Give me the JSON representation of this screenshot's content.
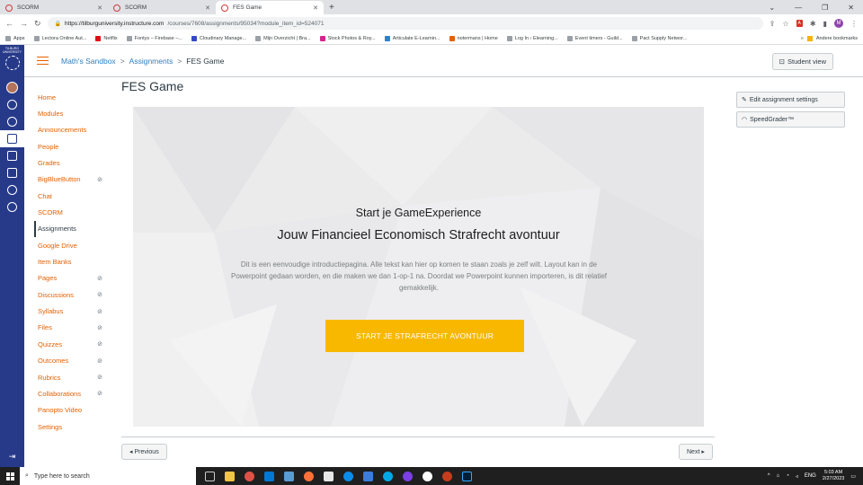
{
  "browser": {
    "tabs": [
      {
        "title": "SCORM",
        "active": false
      },
      {
        "title": "SCORM",
        "active": false
      },
      {
        "title": "FES Game",
        "active": true
      }
    ],
    "url_host": "https://tilburguniversity.instructure.com",
    "url_path": "/courses/7608/assignments/95034?module_item_id=524071",
    "bookmarks": [
      "Apps",
      "Lectora Online Aut...",
      "Netflix",
      "Fontys – Firebase –...",
      "Cloudinary Manage...",
      "Mijn Overzicht | Bra...",
      "Stock Photos & Roy...",
      "Articulate E-Learnin...",
      "notermans | Home",
      "Log In ‹ Elearning...",
      "Event timers - Guild...",
      "Pact Supply Networ..."
    ],
    "bookmarks_more": "»",
    "other_bookmarks": "Andere bookmarks",
    "profile_initial": "M"
  },
  "logo": {
    "line1": "TILBURG",
    "line2": "UNIVERSITY"
  },
  "breadcrumb": {
    "course": "Math's Sandbox",
    "section": "Assignments",
    "current": "FES Game",
    "sep": ">"
  },
  "header": {
    "student_view": "Student view"
  },
  "course_nav": [
    {
      "label": "Home",
      "hidden": false,
      "active": false
    },
    {
      "label": "Modules",
      "hidden": false,
      "active": false
    },
    {
      "label": "Announcements",
      "hidden": false,
      "active": false
    },
    {
      "label": "People",
      "hidden": false,
      "active": false
    },
    {
      "label": "Grades",
      "hidden": false,
      "active": false
    },
    {
      "label": "BigBlueButton",
      "hidden": true,
      "active": false
    },
    {
      "label": "Chat",
      "hidden": false,
      "active": false
    },
    {
      "label": "SCORM",
      "hidden": false,
      "active": false
    },
    {
      "label": "Assignments",
      "hidden": false,
      "active": true
    },
    {
      "label": "Google Drive",
      "hidden": false,
      "active": false
    },
    {
      "label": "Item Banks",
      "hidden": false,
      "active": false
    },
    {
      "label": "Pages",
      "hidden": true,
      "active": false
    },
    {
      "label": "Discussions",
      "hidden": true,
      "active": false
    },
    {
      "label": "Syllabus",
      "hidden": true,
      "active": false
    },
    {
      "label": "Files",
      "hidden": true,
      "active": false
    },
    {
      "label": "Quizzes",
      "hidden": true,
      "active": false
    },
    {
      "label": "Outcomes",
      "hidden": true,
      "active": false
    },
    {
      "label": "Rubrics",
      "hidden": true,
      "active": false
    },
    {
      "label": "Collaborations",
      "hidden": true,
      "active": false
    },
    {
      "label": "Panopto Video",
      "hidden": false,
      "active": false
    },
    {
      "label": "Settings",
      "hidden": false,
      "active": false
    }
  ],
  "main": {
    "title": "FES Game",
    "hero": {
      "kicker": "Start je GameExperience",
      "title": "Jouw Financieel Economisch Strafrecht avontuur",
      "text": "Dit is een eenvoudige introductiepagina. Alle tekst kan hier op komen te staan zoals je zelf wilt. Layout kan in de Powerpoint gedaan worden, en die maken we dan 1-op-1 na. Doordat we Powerpoint kunnen importeren, is dit relatief gemakkelijk.",
      "cta": "START JE STRAFRECHT AVONTUUR"
    },
    "prev": "◂ Previous",
    "next": "Next ▸"
  },
  "sidebar": {
    "edit": "Edit assignment settings",
    "speedgrader": "SpeedGrader™"
  },
  "taskbar": {
    "search_placeholder": "Type here to search",
    "lang": "ENG",
    "time": "5:03 AM",
    "date": "2/27/2023"
  },
  "colors": {
    "brand_nav": "#273a8a",
    "link_orange": "#e66000",
    "cta_yellow": "#f8b800"
  }
}
